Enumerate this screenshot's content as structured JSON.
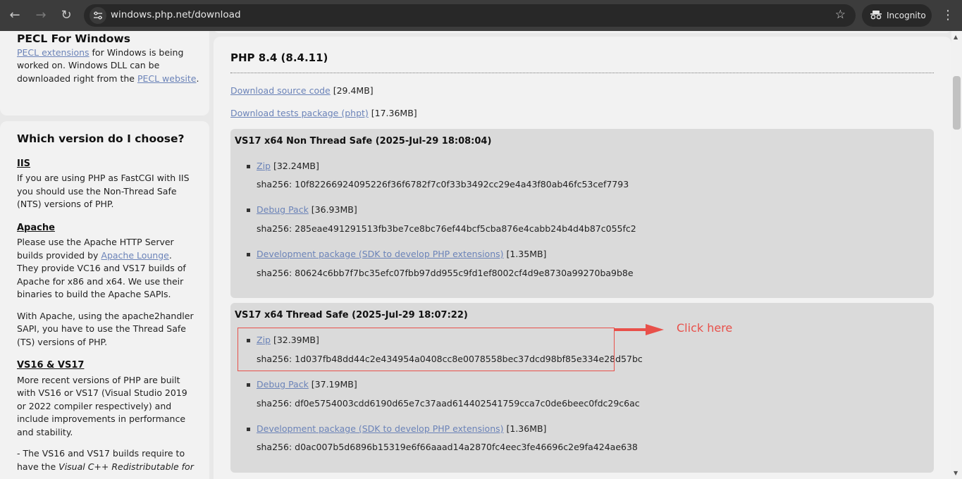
{
  "browser": {
    "url": "windows.php.net/download",
    "incognito_label": "Incognito"
  },
  "sidebar": {
    "pecl": {
      "title": "PECL For Windows",
      "link1": "PECL extensions",
      "text1": " for Windows is being worked on. Windows DLL can be downloaded right from the ",
      "link2": "PECL website",
      "text2": "."
    },
    "choose": {
      "title": "Which version do I choose?",
      "iis_heading": "IIS",
      "iis_text": "If you are using PHP as FastCGI with IIS you should use the Non-Thread Safe (NTS) versions of PHP.",
      "apache_heading": "Apache",
      "apache_text1": "Please use the Apache HTTP Server builds provided by ",
      "apache_link": "Apache Lounge",
      "apache_text2": ". They provide VC16 and VS17 builds of Apache for x86 and x64. We use their binaries to build the Apache SAPIs.",
      "apache_text3": "With Apache, using the apache2handler SAPI, you have to use the Thread Safe (TS) versions of PHP.",
      "vs_heading": "VS16 & VS17",
      "vs_text": "More recent versions of PHP are built with VS16 or VS17 (Visual Studio 2019 or 2022 compiler respectively) and include improvements in performance and stability.",
      "vs_text2_prefix": "- The VS16 and VS17 builds require to have the ",
      "vs_text2_italic": "Visual C++ Redistributable for"
    }
  },
  "main": {
    "title": "PHP 8.4 (8.4.11)",
    "source_link": "Download source code",
    "source_size": " [29.4MB]",
    "tests_link": "Download tests package (phpt)",
    "tests_size": " [17.36MB]",
    "builds": [
      {
        "title": "VS17 x64 Non Thread Safe (2025-Jul-29 18:08:04)",
        "items": [
          {
            "link": "Zip",
            "size": " [32.24MB]",
            "sha": "sha256: 10f82266924095226f36f6782f7c0f33b3492cc29e4a43f80ab46fc53cef7793"
          },
          {
            "link": "Debug Pack",
            "size": " [36.93MB]",
            "sha": "sha256: 285eae491291513fb3be7ce8bc76ef44bcf5cba876e4cabb24b4d4b87c055fc2"
          },
          {
            "link": "Development package (SDK to develop PHP extensions)",
            "size": " [1.35MB]",
            "sha": "sha256: 80624c6bb7f7bc35efc07fbb97dd955c9fd1ef8002cf4d9e8730a99270ba9b8e"
          }
        ]
      },
      {
        "title": "VS17 x64 Thread Safe (2025-Jul-29 18:07:22)",
        "items": [
          {
            "link": "Zip",
            "size": " [32.39MB]",
            "sha": "sha256: 1d037fb48dd44c2e434954a0408cc8e0078558bec37dcd98bf85e334e28d57bc"
          },
          {
            "link": "Debug Pack",
            "size": " [37.19MB]",
            "sha": "sha256: df0e5754003cdd6190d65e7c37aad614402541759cca7c0de6beec0fdc29c6ac"
          },
          {
            "link": "Development package (SDK to develop PHP extensions)",
            "size": " [1.36MB]",
            "sha": "sha256: d0ac007b5d6896b15319e6f66aaad14a2870fc4eec3fe46696c2e9fa424ae638"
          }
        ]
      }
    ]
  },
  "annotation": {
    "label": "Click here",
    "color": "#e8504a"
  }
}
